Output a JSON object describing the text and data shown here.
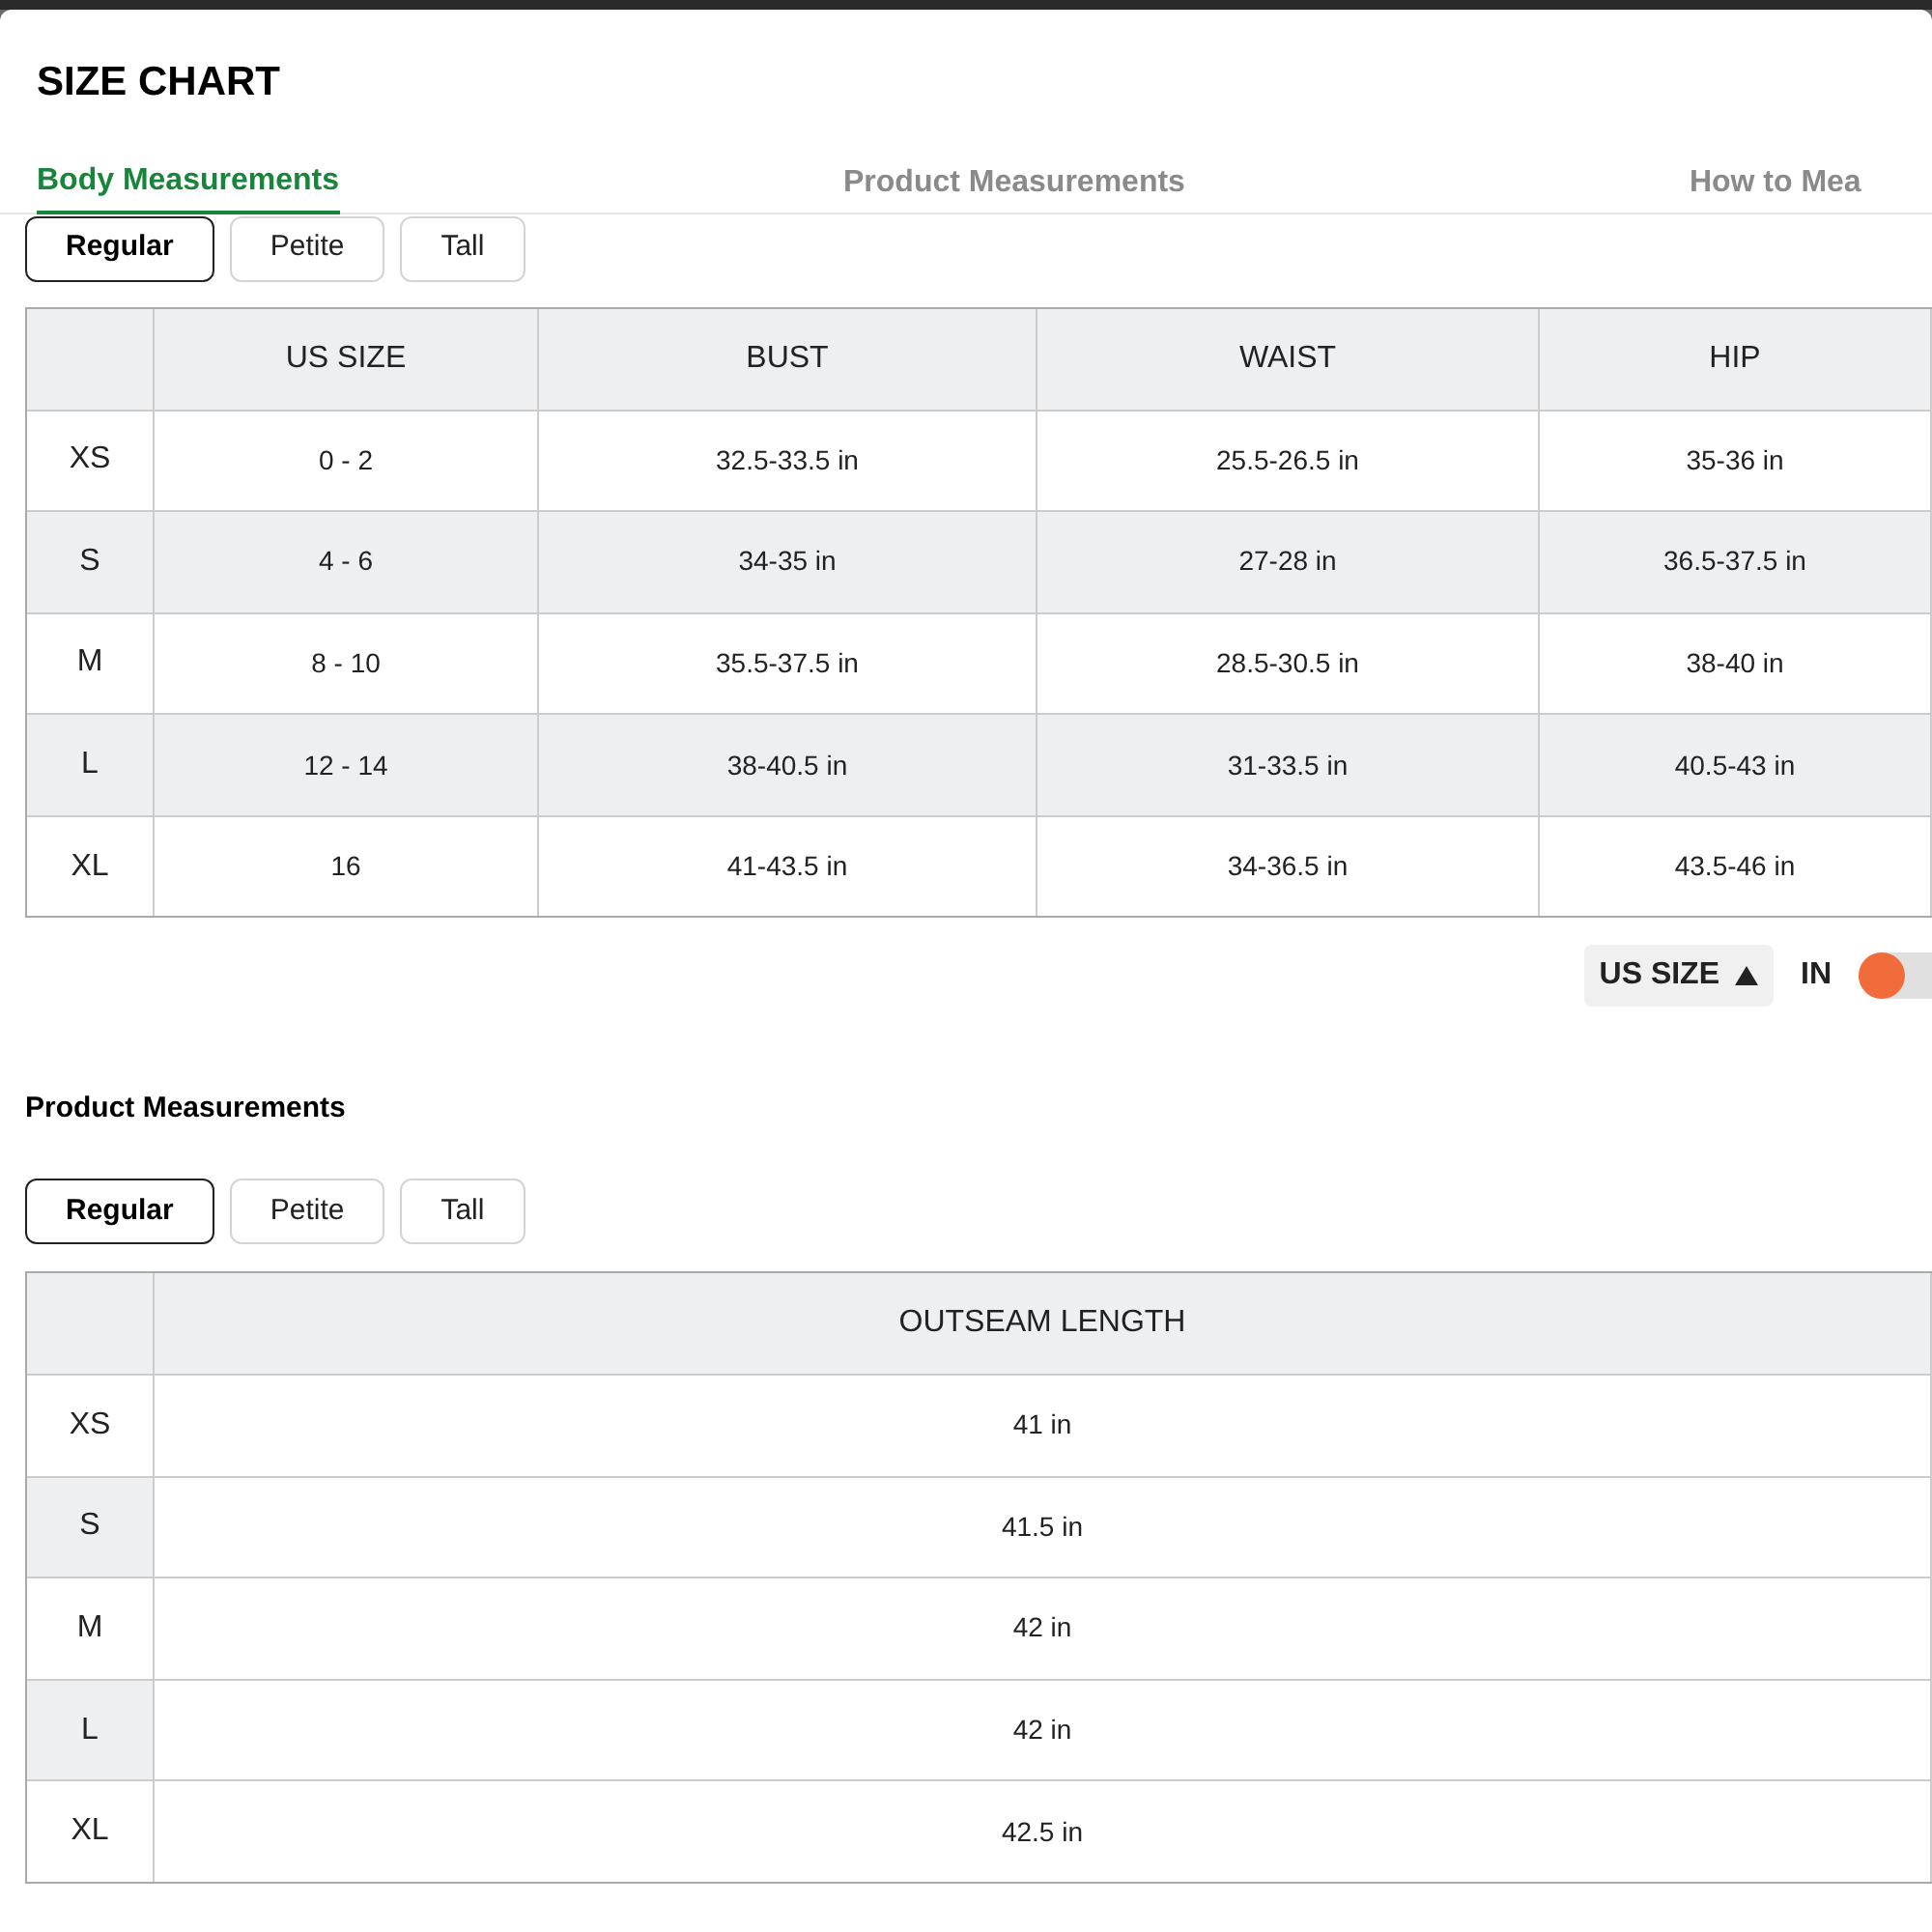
{
  "title": "SIZE CHART",
  "tabs": [
    {
      "label": "Body Measurements",
      "selected": true
    },
    {
      "label": "Product Measurements",
      "selected": false
    },
    {
      "label": "How to Mea",
      "selected": false
    }
  ],
  "body": {
    "fits": [
      {
        "label": "Regular",
        "selected": true
      },
      {
        "label": "Petite",
        "selected": false
      },
      {
        "label": "Tall",
        "selected": false
      }
    ],
    "columns": [
      "",
      "US SIZE",
      "BUST",
      "WAIST",
      "HIP"
    ],
    "rows": [
      [
        "XS",
        "0 - 2",
        "32.5-33.5 in",
        "25.5-26.5 in",
        "35-36 in"
      ],
      [
        "S",
        "4 - 6",
        "34-35 in",
        "27-28 in",
        "36.5-37.5 in"
      ],
      [
        "M",
        "8 - 10",
        "35.5-37.5 in",
        "28.5-30.5 in",
        "38-40 in"
      ],
      [
        "L",
        "12 - 14",
        "38-40.5 in",
        "31-33.5 in",
        "40.5-43 in"
      ],
      [
        "XL",
        "16",
        "41-43.5 in",
        "34-36.5 in",
        "43.5-46 in"
      ]
    ],
    "sort": {
      "label": "US SIZE"
    },
    "unit_toggle": {
      "label": "IN",
      "on": false
    }
  },
  "product": {
    "heading": "Product Measurements",
    "fits": [
      {
        "label": "Regular",
        "selected": true
      },
      {
        "label": "Petite",
        "selected": false
      },
      {
        "label": "Tall",
        "selected": false
      }
    ],
    "columns": [
      "",
      "OUTSEAM LENGTH"
    ],
    "rows": [
      [
        "XS",
        "41 in"
      ],
      [
        "S",
        "41.5 in"
      ],
      [
        "M",
        "42 in"
      ],
      [
        "L",
        "42 in"
      ],
      [
        "XL",
        "42.5 in"
      ]
    ]
  }
}
